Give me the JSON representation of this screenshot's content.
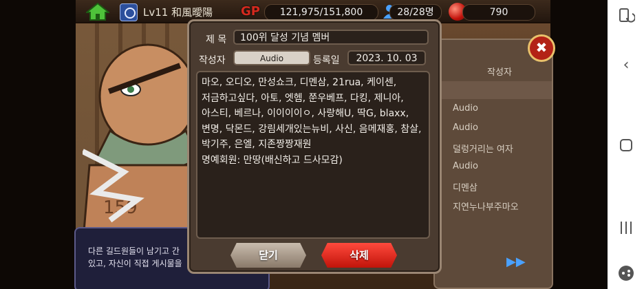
{
  "topbar": {
    "guild_level": "Lv11 和風曖陽",
    "gp_label": "GP",
    "gp_value": "121,975/151,800",
    "members": "28/28명",
    "gems": "790"
  },
  "list_panel": {
    "header": "작성자",
    "authors": [
      "Audio",
      "Audio",
      "덜렁거리는 여자",
      "Audio",
      "디멘삼",
      "지연누나부주마오"
    ]
  },
  "desc_panel": {
    "text": "다른 길드원들이 남기고 간\n있고, 자신이 직접 게시물을"
  },
  "modal": {
    "title_label": "제 목",
    "title_value": "100위 달성 기념 멤버",
    "author_label": "작성자",
    "author_value": "Audio",
    "date_label": "등록일",
    "date_value": "2023. 10. 03",
    "content_lines": [
      "마오, 오디오, 만성쇼크, 디멘삼, 21rua, 케이센,",
      "저금하고싶다, 아토, 엣헴, 쭌우베프, 다킹, 제니아,",
      "아스티, 베르나, 이이이이ㅇ, 사랑해U, 딱G, blaxx,",
      "변명, 닥몬드, 강림세개있는뉴비, 사신, 음메재홍, 참살,",
      "박기주, 은엘, 지존짱짱재원",
      "명예회원: 만땅(배신하고 드사모감)"
    ],
    "close_label": "닫기",
    "delete_label": "삭제"
  },
  "colors": {
    "delete_button": "#e0241a",
    "close_button": "#a89886",
    "gp_text": "#d5291e",
    "modal_bg": "#4a3b30"
  }
}
